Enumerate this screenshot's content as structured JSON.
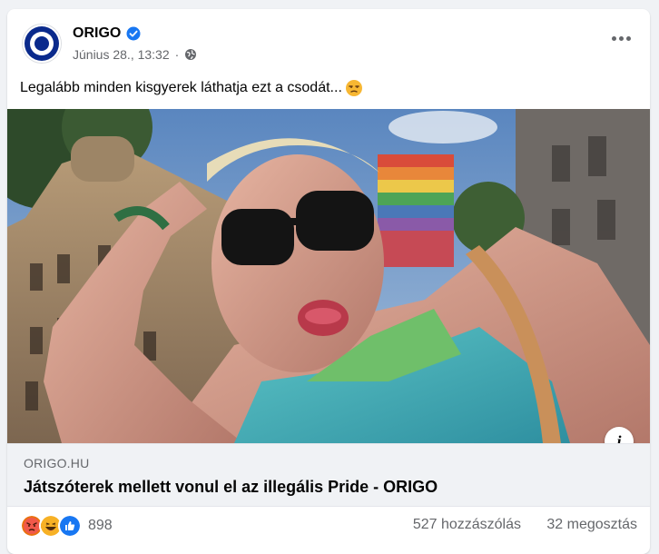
{
  "post": {
    "page_name": "ORIGO",
    "timestamp": "Június 28., 13:32",
    "separator": "·",
    "text": "Legalább minden kisgyerek láthatja ezt a csodát...",
    "icons": {
      "avatar": "origo-logo-icon",
      "verified": "verified-badge-icon",
      "audience": "globe-icon",
      "more": "more-options-icon",
      "emoji": "unamused-face-icon"
    },
    "colors": {
      "verified": "#1877f2",
      "origo_blue": "#0a2a8c",
      "secondary_text": "#65676b"
    }
  },
  "link": {
    "domain": "ORIGO.HU",
    "title": "Játszóterek mellett vonul el az illegális Pride - ORIGO",
    "info_icon": "info-icon",
    "info_label": "i"
  },
  "footer": {
    "reactions": [
      "angry-reaction-icon",
      "haha-reaction-icon",
      "like-reaction-icon"
    ],
    "reaction_count": "898",
    "comments": "527 hozzászólás",
    "shares": "32 megosztás"
  }
}
